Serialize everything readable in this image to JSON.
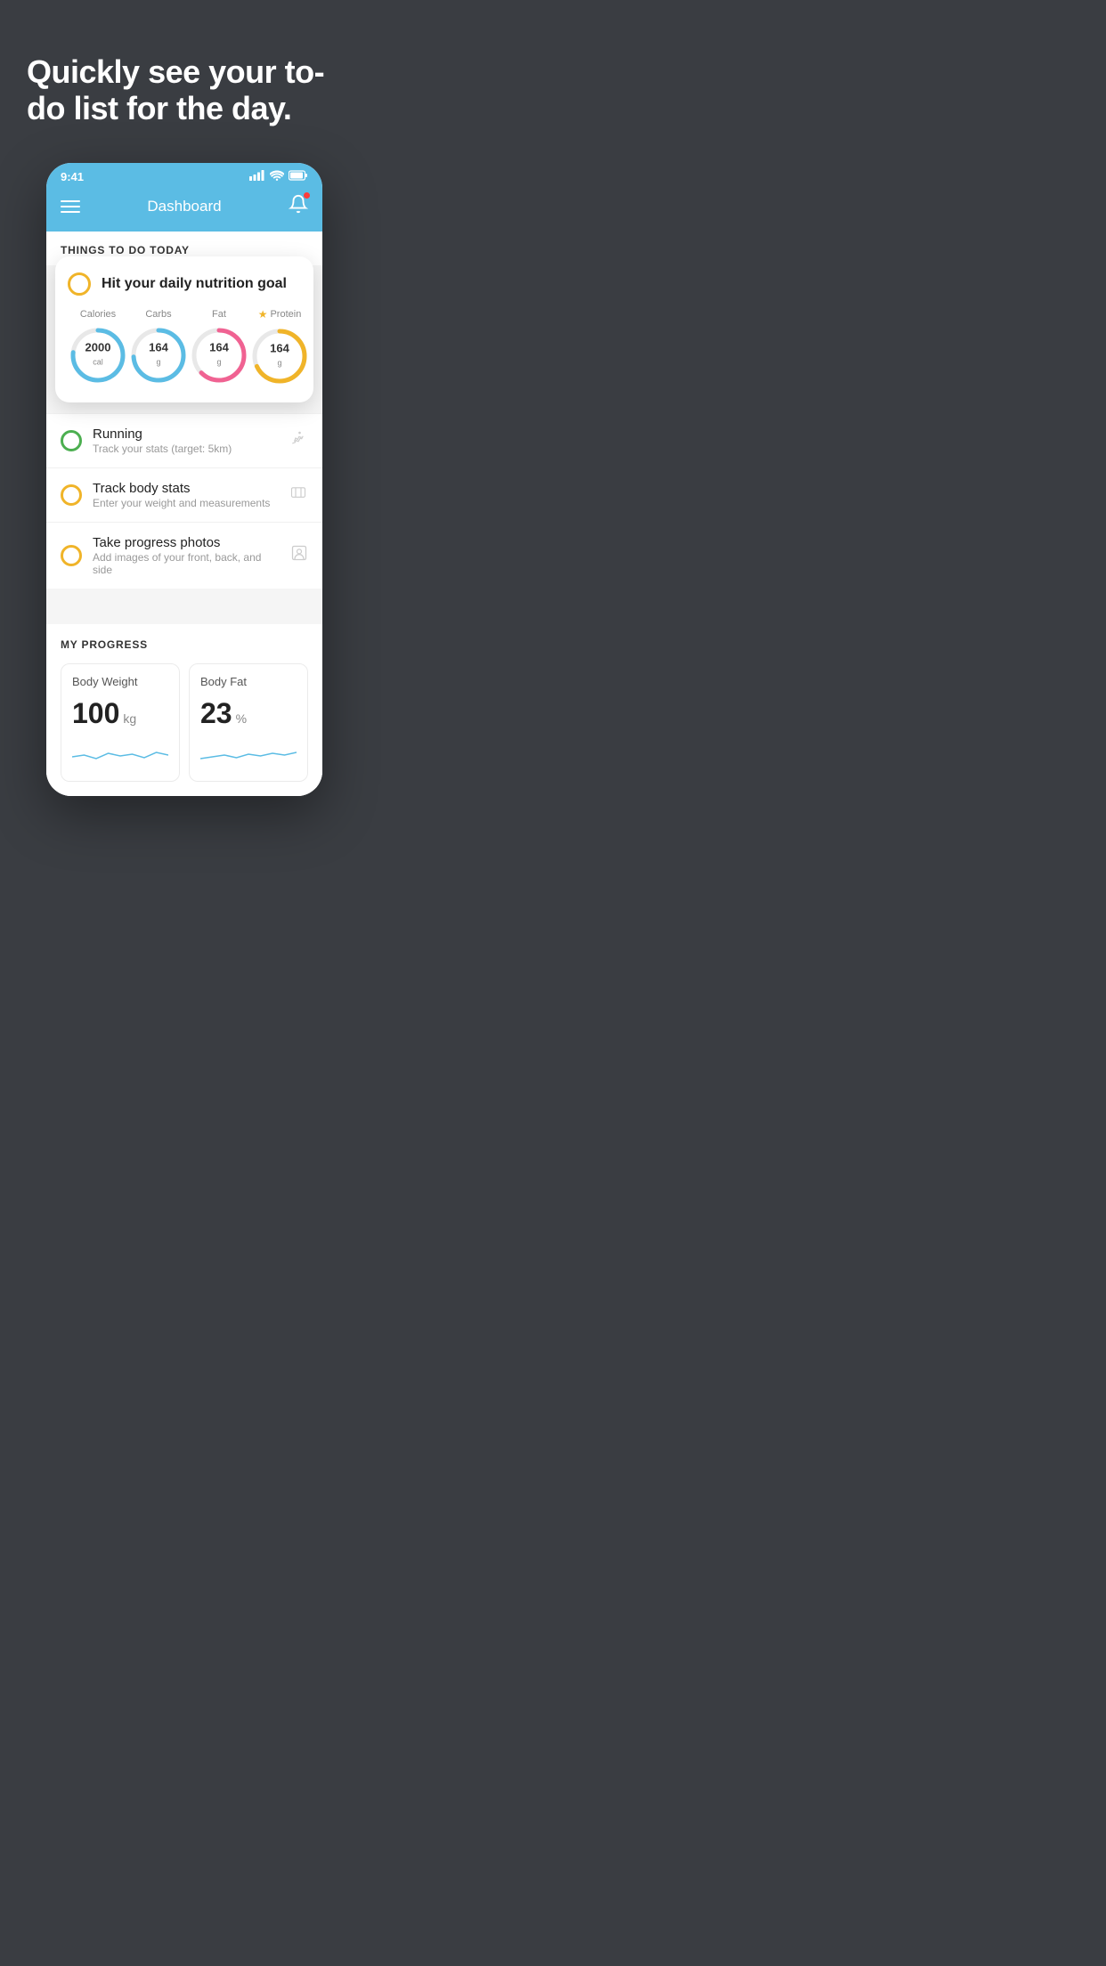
{
  "hero": {
    "title": "Quickly see your to-do list for the day."
  },
  "phone": {
    "status_bar": {
      "time": "9:41",
      "signal": "▲▲▲",
      "wifi": "wifi",
      "battery": "battery"
    },
    "nav": {
      "title": "Dashboard"
    },
    "things_today": {
      "section_label": "THINGS TO DO TODAY",
      "featured_card": {
        "check_color": "#f0b429",
        "title": "Hit your daily nutrition goal",
        "nutrients": [
          {
            "label": "Calories",
            "star": false,
            "value": "2000",
            "unit": "cal",
            "color": "#5bbce4",
            "dasharray": "150 200"
          },
          {
            "label": "Carbs",
            "star": false,
            "value": "164",
            "unit": "g",
            "color": "#5bbce4",
            "dasharray": "110 200"
          },
          {
            "label": "Fat",
            "star": false,
            "value": "164",
            "unit": "g",
            "color": "#f06292",
            "dasharray": "100 200"
          },
          {
            "label": "Protein",
            "star": true,
            "value": "164",
            "unit": "g",
            "color": "#f0b429",
            "dasharray": "120 200"
          }
        ]
      },
      "todo_items": [
        {
          "circle_color": "green",
          "title": "Running",
          "subtitle": "Track your stats (target: 5km)",
          "icon": "👟"
        },
        {
          "circle_color": "yellow",
          "title": "Track body stats",
          "subtitle": "Enter your weight and measurements",
          "icon": "⚖️"
        },
        {
          "circle_color": "yellow",
          "title": "Take progress photos",
          "subtitle": "Add images of your front, back, and side",
          "icon": "👤"
        }
      ]
    },
    "progress": {
      "section_label": "MY PROGRESS",
      "cards": [
        {
          "title": "Body Weight",
          "value": "100",
          "unit": "kg"
        },
        {
          "title": "Body Fat",
          "value": "23",
          "unit": "%"
        }
      ]
    }
  }
}
